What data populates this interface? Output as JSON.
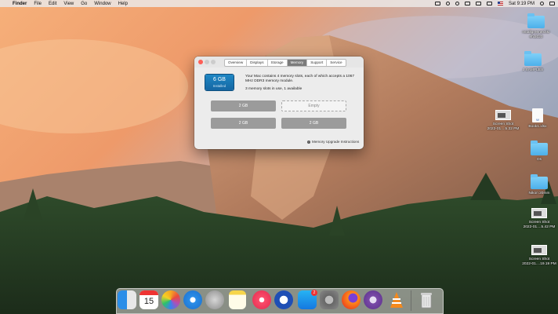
{
  "menubar": {
    "apple_symbol": "",
    "menus": [
      "Finder",
      "File",
      "Edit",
      "View",
      "Go",
      "Window",
      "Help"
    ],
    "clock": "Sat 9:19 PM"
  },
  "window": {
    "tabs": [
      "Overview",
      "Displays",
      "Storage",
      "Memory",
      "Support",
      "Service"
    ],
    "active_tab": "Memory",
    "ram_total": "6 GB",
    "ram_caption": "Installed",
    "description": "Your Mac contains 4 memory slots, each of which accepts a 1067 MHz DDR3 memory module.",
    "slots_summary": "3 memory slots in use, 1 available",
    "slots": [
      "2 GB",
      "Empty",
      "2 GB",
      "2 GB"
    ],
    "upgrade_link": "Memory Upgrade Instructions"
  },
  "desktop_icons": [
    {
      "label_line1": "nstallgreenexnkr",
      "label_line2": "efv2020",
      "kind": "folder"
    },
    {
      "label_line1": "J SAMPLES",
      "label_line2": "",
      "kind": "folder"
    },
    {
      "label_line1": "Screen Shot",
      "label_line2": "2022-01....5.32 PM",
      "kind": "screenshot"
    },
    {
      "label_line1": "Book1.xlsx",
      "label_line2": "",
      "kind": "document"
    },
    {
      "label_line1": "Os",
      "label_line2": "",
      "kind": "folder"
    },
    {
      "label_line1": "Nikon 20mm",
      "label_line2": "",
      "kind": "folder"
    },
    {
      "label_line1": "Screen Shot",
      "label_line2": "2022-01....5.42 PM",
      "kind": "screenshot"
    },
    {
      "label_line1": "Screen Shot",
      "label_line2": "2022-01....19.19 PM",
      "kind": "screenshot"
    }
  ],
  "dock": {
    "calendar_day": "15",
    "appstore_badge": "2",
    "apps": [
      "finder-icon",
      "calendar-icon",
      "photos-icon",
      "safari-icon",
      "launchpad-icon",
      "notes-icon",
      "music-icon",
      "vpn-icon",
      "app-store-icon",
      "system-preferences-icon",
      "firefox-icon",
      "tor-icon",
      "vlc-icon",
      "trash-icon"
    ]
  }
}
